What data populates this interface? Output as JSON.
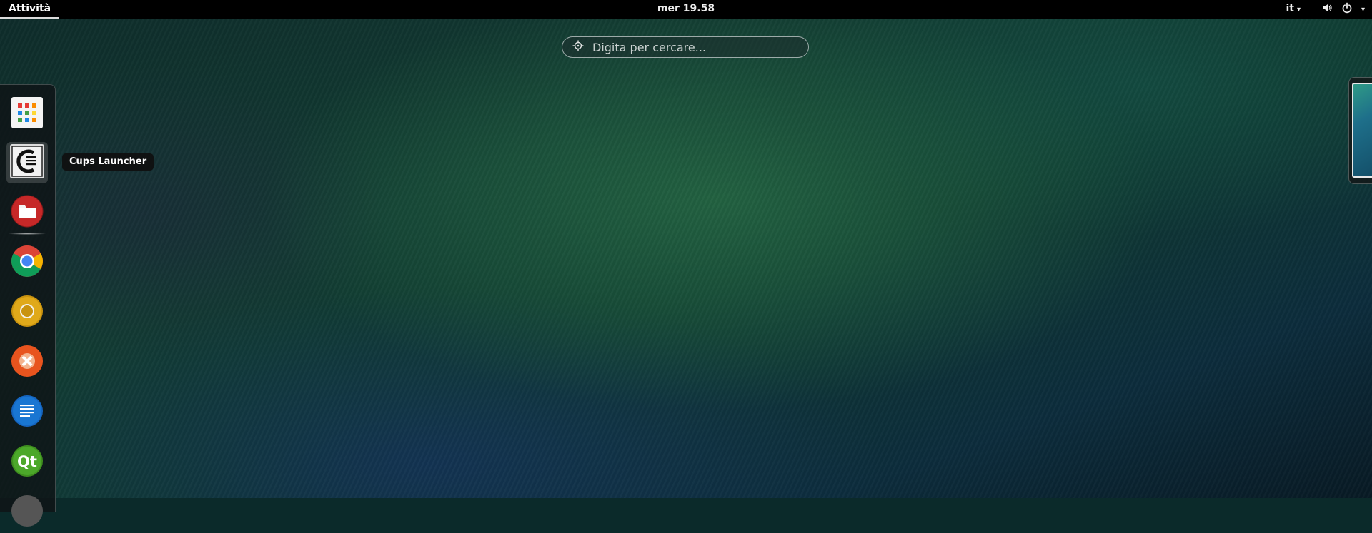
{
  "topbar": {
    "activities_label": "Attività",
    "clock": "mer 19.58",
    "language": "it",
    "language_caret": "▾",
    "system_caret": "▾"
  },
  "search": {
    "placeholder": "Digita per cercare..."
  },
  "dash": {
    "tooltip": "Cups Launcher",
    "items": [
      {
        "name": "Applicazioni",
        "icon": "app-grid-icon"
      },
      {
        "name": "Cups Launcher",
        "icon": "cups-icon"
      },
      {
        "name": "File",
        "icon": "files-icon"
      },
      {
        "name": "Google Chrome",
        "icon": "chrome-icon"
      },
      {
        "name": "Chromium",
        "icon": "chromium-icon"
      },
      {
        "name": "Crossover",
        "icon": "crossover-icon"
      },
      {
        "name": "Text Editor",
        "icon": "text-editor-icon"
      },
      {
        "name": "Qt Creator",
        "icon": "qt-icon"
      }
    ],
    "qt_label": "Qt"
  },
  "colors": {
    "topbar": "#000000",
    "tooltip_bg": "#0f0f0f",
    "accent_text": "#eeeeee"
  }
}
